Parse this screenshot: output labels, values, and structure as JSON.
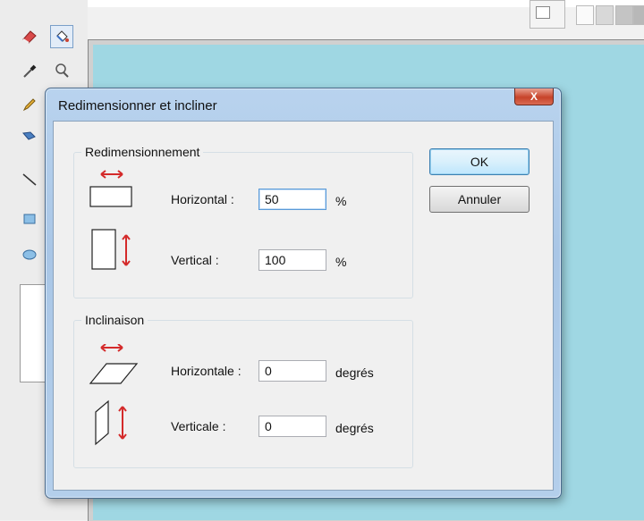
{
  "dialog": {
    "title": "Redimensionner et incliner",
    "close_label": "X",
    "resize": {
      "label": "Redimensionnement",
      "horizontal_label": "Horizontal :",
      "horizontal_value": "50",
      "horizontal_unit": "%",
      "vertical_label": "Vertical :",
      "vertical_value": "100",
      "vertical_unit": "%"
    },
    "skew": {
      "label": "Inclinaison",
      "horizontal_label": "Horizontale :",
      "horizontal_value": "0",
      "horizontal_unit": "degrés",
      "vertical_label": "Verticale :",
      "vertical_value": "0",
      "vertical_unit": "degrés"
    },
    "ok_label": "OK",
    "cancel_label": "Annuler"
  },
  "colors": {
    "canvas": "#9fd7e3",
    "arrow_red": "#d42a2a",
    "title_bar": "#b3cdea",
    "close_red": "#c7432a"
  },
  "toolbox": {
    "tools": [
      "eraser-icon",
      "fill-bucket-icon",
      "color-picker-icon",
      "magnifier-icon",
      "pencil-icon",
      "brush-icon",
      "line-icon",
      "rectangle-icon",
      "ellipse-icon"
    ],
    "selected": "fill-bucket-icon"
  }
}
